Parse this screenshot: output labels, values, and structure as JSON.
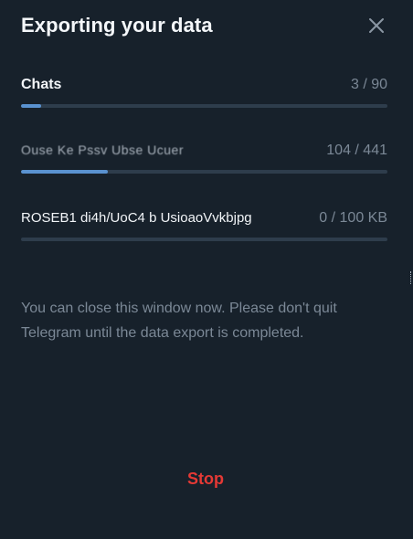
{
  "dialog": {
    "title": "Exporting your data",
    "close_icon": "close-icon"
  },
  "progress": {
    "chats": {
      "label": "Chats",
      "value": "3 / 90",
      "fraction": 0.0556
    },
    "messages": {
      "label": "Ouse Ke Pssv Ubse Ucuer",
      "value": "104 / 441",
      "fraction": 0.2358
    },
    "file": {
      "label": "ROSEB1 di4h/UoC4 b UsioaoVvkbjpg",
      "value": "0 / 100 KB",
      "fraction": 0.0
    }
  },
  "note": "You can close this window now. Please don't quit Telegram until the data export is completed.",
  "stop_label": "Stop",
  "colors": {
    "background": "#17212b",
    "accent": "#5a92d0",
    "danger": "#e53935",
    "muted": "#7b8896"
  }
}
